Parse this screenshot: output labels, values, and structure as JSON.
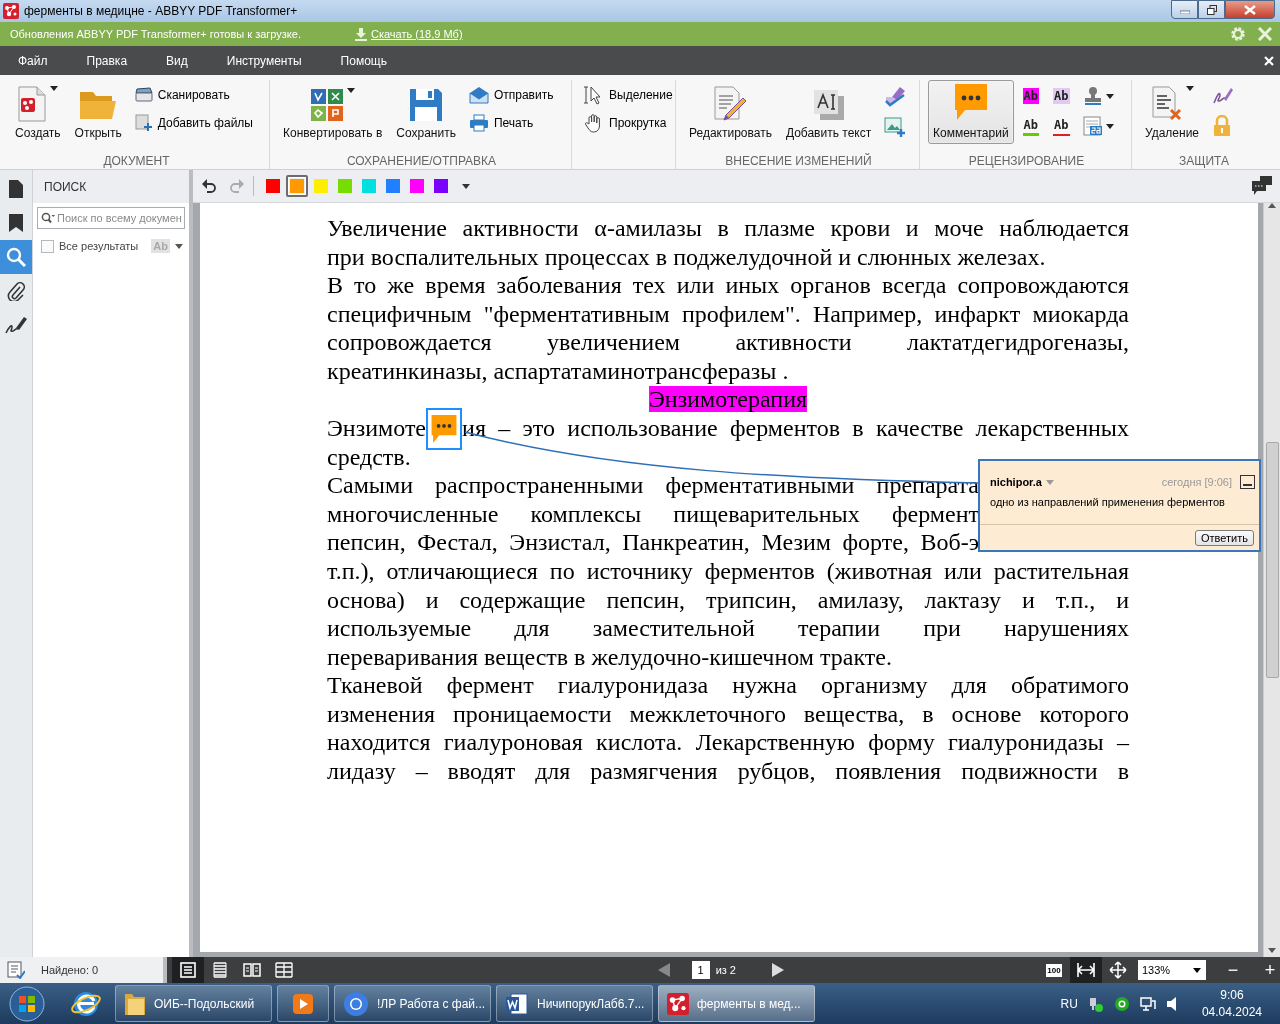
{
  "window": {
    "title": "ферменты в медицне - ABBYY PDF Transformer+"
  },
  "update_bar": {
    "message": "Обновления ABBYY PDF Transformer+ готовы к загрузке.",
    "link": "Скачать (18,9 Мб)"
  },
  "menu": [
    {
      "label": "Файл"
    },
    {
      "label": "Правка"
    },
    {
      "label": "Вид"
    },
    {
      "label": "Инструменты"
    },
    {
      "label": "Помощь"
    }
  ],
  "ribbon": {
    "groups": [
      {
        "title": "ДОКУМЕНТ",
        "items": [
          {
            "kind": "large",
            "label": "Создать",
            "dropdown": true,
            "selected": false
          },
          {
            "kind": "large",
            "label": "Открыть",
            "dropdown": false,
            "selected": false
          },
          {
            "kind": "small",
            "label": "Сканировать",
            "selected": false
          },
          {
            "kind": "small",
            "label": "Добавить файлы",
            "selected": false
          }
        ]
      },
      {
        "title": "СОХРАНЕНИЕ/ОТПРАВКА",
        "items": [
          {
            "kind": "large",
            "label": "Конвертировать в",
            "dropdown": true,
            "selected": false
          },
          {
            "kind": "large",
            "label": "Сохранить",
            "dropdown": false,
            "selected": false
          },
          {
            "kind": "small",
            "label": "Отправить",
            "selected": false
          },
          {
            "kind": "small",
            "label": "Печать",
            "selected": false
          }
        ]
      },
      {
        "items": [
          {
            "kind": "small",
            "label": "Выделение",
            "selected": false
          },
          {
            "kind": "small",
            "label": "Прокрутка",
            "selected": false
          }
        ]
      },
      {
        "title": "ВНЕСЕНИЕ ИЗМЕНЕНИЙ",
        "items": [
          {
            "kind": "large",
            "label": "Редактировать",
            "dropdown": false,
            "selected": false
          },
          {
            "kind": "large",
            "label": "Добавить текст",
            "dropdown": false,
            "selected": false
          },
          {
            "kind": "tool",
            "dropdown": false,
            "selected": false
          },
          {
            "kind": "tool",
            "dropdown": false,
            "selected": false
          }
        ]
      },
      {
        "title": "РЕЦЕНЗИРОВАНИЕ",
        "items": [
          {
            "kind": "large",
            "label": "Комментарий",
            "dropdown": false,
            "selected": true
          },
          {
            "kind": "highlight",
            "label": "Ab",
            "selected": false
          },
          {
            "kind": "underline",
            "label": "Ab",
            "selected": false
          },
          {
            "kind": "replace",
            "label": "Ab",
            "selected": false
          },
          {
            "kind": "strikeout",
            "label": "Ab",
            "selected": false
          },
          {
            "kind": "tool",
            "dropdown": true,
            "selected": false
          },
          {
            "kind": "tool",
            "dropdown": true,
            "selected": false
          }
        ]
      },
      {
        "title": "ЗАЩИТА",
        "items": [
          {
            "kind": "large",
            "label": "Удаление",
            "dropdown": true,
            "selected": false
          },
          {
            "kind": "tool",
            "dropdown": false,
            "selected": false
          },
          {
            "kind": "tool",
            "dropdown": false,
            "selected": false
          }
        ]
      }
    ]
  },
  "side_tabs": [
    {
      "selected": false
    },
    {
      "selected": false
    },
    {
      "selected": true
    },
    {
      "selected": false
    },
    {
      "selected": false
    }
  ],
  "search_panel": {
    "title": "ПОИСК",
    "placeholder": "Поиск по всему докумен",
    "all_results": {
      "label": "Все результаты",
      "checked": false
    },
    "case_button": "Ab"
  },
  "doc_toolbar": {
    "colors": [
      {
        "color": "#ff0000",
        "selected": false
      },
      {
        "color": "#ff9900",
        "selected": true
      },
      {
        "color": "#ffee00",
        "selected": false
      },
      {
        "color": "#77dd00",
        "selected": false
      },
      {
        "color": "#00e0e0",
        "selected": false
      },
      {
        "color": "#2080ff",
        "selected": false
      },
      {
        "color": "#ff00ff",
        "selected": false
      },
      {
        "color": "#7a00ff",
        "selected": false
      }
    ]
  },
  "document": {
    "lines": [
      {
        "kind": "justify",
        "text": "Увеличение активности α-амилазы в плазме крови и моче наблюдается"
      },
      {
        "kind": "left",
        "text": "при воспалительных процессах в поджелудочной и слюнных железах."
      },
      {
        "kind": "justify",
        "text": "В то же время заболевания тех или иных органов всегда сопровождаются"
      },
      {
        "kind": "justify",
        "text": "специфичным \"ферментативным профилем\". Например, инфаркт миокарда"
      },
      {
        "kind": "justify",
        "text": "сопровождается увеличением активности лактатдегидрогеназы,"
      },
      {
        "kind": "left",
        "text": "креатинкиназы, аспартатаминотрансферазы ."
      },
      {
        "kind": "heading",
        "text": "Энзимотерапия"
      },
      {
        "kind": "anchored",
        "parts": [
          "Энзимоте",
          "ия – это использование ферментов в качестве лекарственных"
        ]
      },
      {
        "kind": "left",
        "text": "средств."
      },
      {
        "kind": "cut",
        "text": "Самыми распространенными ферментативными препарата"
      },
      {
        "kind": "cut",
        "text": "многочисленные комплексы пищеварительных фермент"
      },
      {
        "kind": "cut",
        "text": "пепсин, Фестал, Энзистал, Панкреатин, Мезим форте, Воб-э"
      },
      {
        "kind": "justify",
        "text": "т.п.), отличающиеся по источнику ферментов (животная или растительная"
      },
      {
        "kind": "justify",
        "text": "основа)  и содержащие пепсин, трипсин, амилазу, лактазу и т.п., и"
      },
      {
        "kind": "justify",
        "text": "используемые для заместительной терапии при нарушениях"
      },
      {
        "kind": "left",
        "text": "переваривания веществ в желудочно-кишечном тракте."
      },
      {
        "kind": "justify",
        "text": "Тканевой фермент гиалуронидаза нужна организму для обратимого"
      },
      {
        "kind": "justify",
        "text": "изменения проницаемости межклеточного вещества, в основе которого"
      },
      {
        "kind": "justify",
        "text": "находится гиалуроновая кислота. Лекарственную форму гиалуронидазы –"
      },
      {
        "kind": "justify",
        "text": "лидазу – вводят для размягчения рубцов, появления подвижности в"
      }
    ],
    "note": {
      "author": "nichipor.a",
      "time": "сегодня [9:06]",
      "text": "одно из направлений применения ферментов",
      "reply": "Ответить"
    }
  },
  "status_bar": {
    "found": "Найдено: 0",
    "views": [
      {
        "selected": true
      },
      {
        "selected": false
      },
      {
        "selected": false
      },
      {
        "selected": false
      }
    ],
    "page": "1",
    "page_total": "из 2",
    "fit_modes": [
      {
        "label": "100",
        "selected": false
      },
      {
        "selected": true
      },
      {
        "selected": false
      }
    ],
    "zoom": "133%",
    "zoom_out": "−",
    "zoom_in": "+"
  },
  "taskbar": {
    "buttons": [
      {
        "kind": "pinned",
        "selected": false
      },
      {
        "kind": "window",
        "label": "ОИБ--Подольский",
        "selected": false
      },
      {
        "kind": "pinned",
        "selected": false
      },
      {
        "kind": "window",
        "label": "!ЛР Работа с фай...",
        "selected": false
      },
      {
        "kind": "window",
        "label": "НичипорукЛаб6.7...",
        "selected": false
      },
      {
        "kind": "window",
        "label": "ферменты в мед...",
        "selected": true
      }
    ],
    "tray": {
      "language": "RU",
      "time": "9:06",
      "date": "04.04.2024"
    }
  }
}
